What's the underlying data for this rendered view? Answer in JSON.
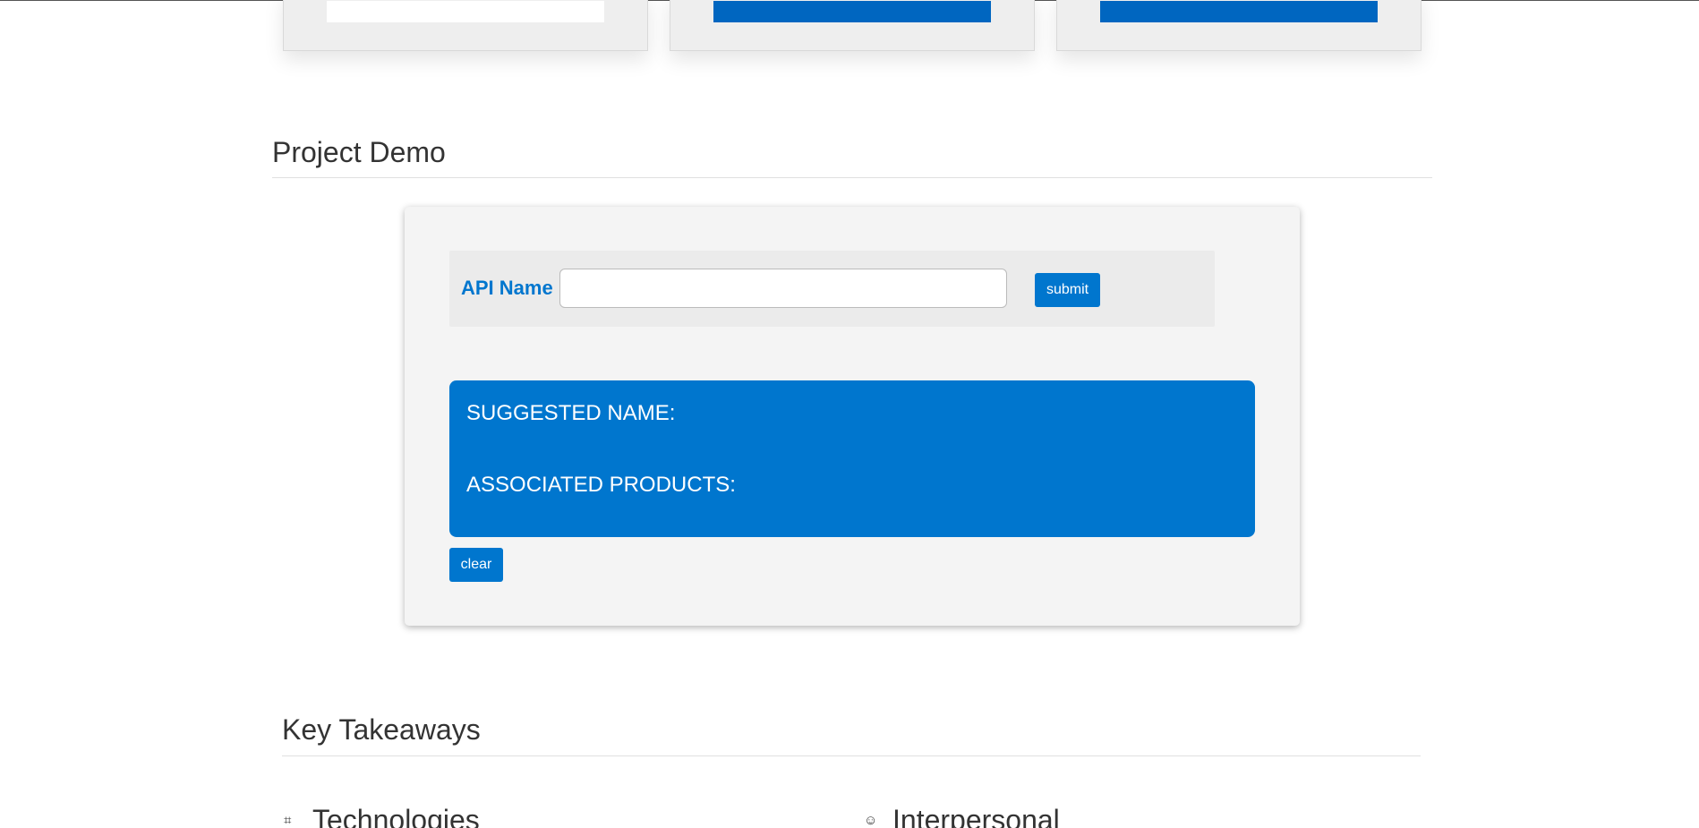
{
  "cards": [
    {
      "fill_color": "#ffffff"
    },
    {
      "fill_color": "#0066c0"
    },
    {
      "fill_color": "#0066c0"
    }
  ],
  "project_demo": {
    "title": "Project Demo",
    "form": {
      "label": "API Name",
      "input_value": "",
      "input_placeholder": "",
      "submit_label": "submit"
    },
    "result": {
      "suggested_name_label": "SUGGESTED NAME:",
      "associated_products_label": "ASSOCIATED PRODUCTS:"
    },
    "clear_label": "clear"
  },
  "key_takeaways": {
    "title": "Key Takeaways",
    "items": [
      {
        "icon": "chip-icon",
        "glyph": "⌗",
        "title": "Technologies"
      },
      {
        "icon": "sunglasses-face-icon",
        "glyph": "☺",
        "title": "Interpersonal"
      }
    ]
  },
  "colors": {
    "accent": "#0076ce",
    "panel_background": "#f4f4f4",
    "text": "#333333"
  }
}
